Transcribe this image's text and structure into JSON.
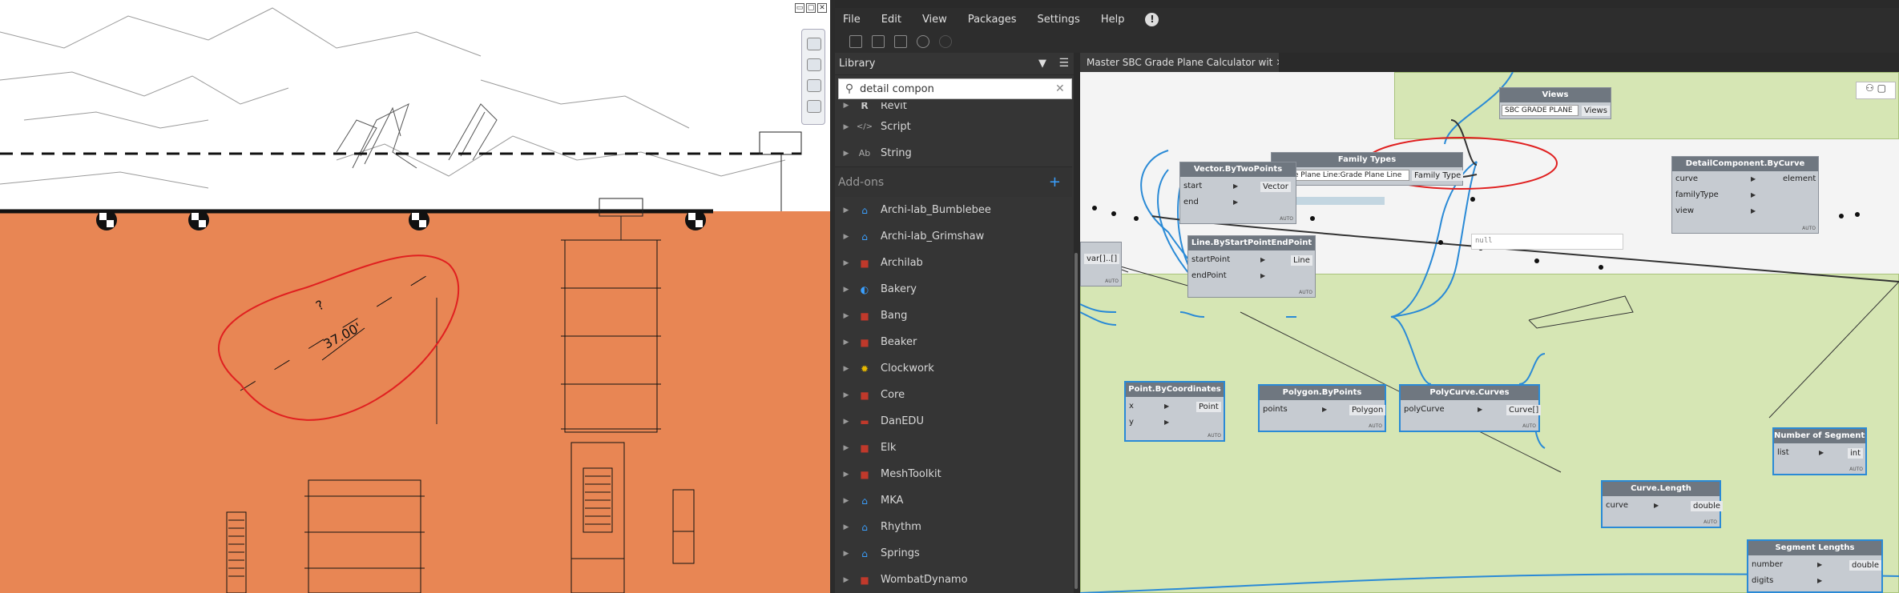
{
  "revit": {
    "window_buttons": [
      "▭",
      "▢",
      "✕"
    ],
    "annotation": {
      "question": "?",
      "dimension": "37.00'"
    }
  },
  "dynamo": {
    "menu": [
      "File",
      "Edit",
      "View",
      "Packages",
      "Settings",
      "Help"
    ],
    "help_icon": "!",
    "library": {
      "title": "Library",
      "search_value": "detail compon",
      "categories": [
        {
          "label": "Revit",
          "icon": "R"
        },
        {
          "label": "Script",
          "icon": "</>"
        },
        {
          "label": "String",
          "icon": "Ab"
        }
      ],
      "addons_label": "Add-ons",
      "addons": [
        {
          "label": "Archi-lab_Bumblebee",
          "icon": "⌂",
          "color": "#3aa0ff"
        },
        {
          "label": "Archi-lab_Grimshaw",
          "icon": "⌂",
          "color": "#3aa0ff"
        },
        {
          "label": "Archilab",
          "icon": "■",
          "color": "#c0392b"
        },
        {
          "label": "Bakery",
          "icon": "◐",
          "color": "#3aa0ff"
        },
        {
          "label": "Bang",
          "icon": "■",
          "color": "#c0392b"
        },
        {
          "label": "Beaker",
          "icon": "■",
          "color": "#c0392b"
        },
        {
          "label": "Clockwork",
          "icon": "✹",
          "color": "#e6b800"
        },
        {
          "label": "Core",
          "icon": "■",
          "color": "#c0392b"
        },
        {
          "label": "DanEDU",
          "icon": "▬",
          "color": "#c0392b"
        },
        {
          "label": "Elk",
          "icon": "■",
          "color": "#c0392b"
        },
        {
          "label": "MeshToolkit",
          "icon": "■",
          "color": "#c0392b"
        },
        {
          "label": "MKA",
          "icon": "⌂",
          "color": "#3aa0ff"
        },
        {
          "label": "Rhythm",
          "icon": "⌂",
          "color": "#3aa0ff"
        },
        {
          "label": "Springs",
          "icon": "⌂",
          "color": "#3aa0ff"
        },
        {
          "label": "WombatDynamo",
          "icon": "■",
          "color": "#c0392b"
        }
      ]
    },
    "tab_title": "Master SBC Grade Plane Calculator wit",
    "nodes": {
      "views": {
        "title": "Views",
        "dropdown": "SBC GRADE PLANE",
        "output": "Views"
      },
      "family_types": {
        "title": "Family Types",
        "dropdown": "Grade Plane Line:Grade Plane Line",
        "output": "Family Type"
      },
      "detail_component": {
        "title": "DetailComponent.ByCurve",
        "inputs": [
          "curve",
          "familyType",
          "view"
        ],
        "output": "element",
        "preview": "null"
      },
      "vector": {
        "title": "Vector.ByTwoPoints",
        "inputs": [
          "start",
          "end"
        ],
        "output": "Vector"
      },
      "line": {
        "title": "Line.ByStartPointEndPoint",
        "inputs": [
          "startPoint",
          "endPoint"
        ],
        "output": "Line"
      },
      "code_block": {
        "output": "var[]..[]"
      },
      "point": {
        "title": "Point.ByCoordinates",
        "inputs": [
          "x",
          "y"
        ],
        "output": "Point"
      },
      "polygon": {
        "title": "Polygon.ByPoints",
        "inputs": [
          "points"
        ],
        "output": "Polygon"
      },
      "polycurve": {
        "title": "PolyCurve.Curves",
        "inputs": [
          "polyCurve"
        ],
        "output": "Curve[]"
      },
      "curve_length": {
        "title": "Curve.Length",
        "inputs": [
          "curve"
        ],
        "output": "double"
      },
      "num_segments": {
        "title": "Number of Segments",
        "inputs": [
          "list"
        ],
        "output": "int"
      },
      "segment_lengths": {
        "title": "Segment Lengths",
        "inputs": [
          "number",
          "digits"
        ],
        "output": "double"
      }
    },
    "auto_label": "AUTO",
    "colors": {
      "wire": "#2a8ad6",
      "group": "#d6e6b4",
      "node_title": "#6f7780",
      "highlight": "#e02020"
    }
  }
}
